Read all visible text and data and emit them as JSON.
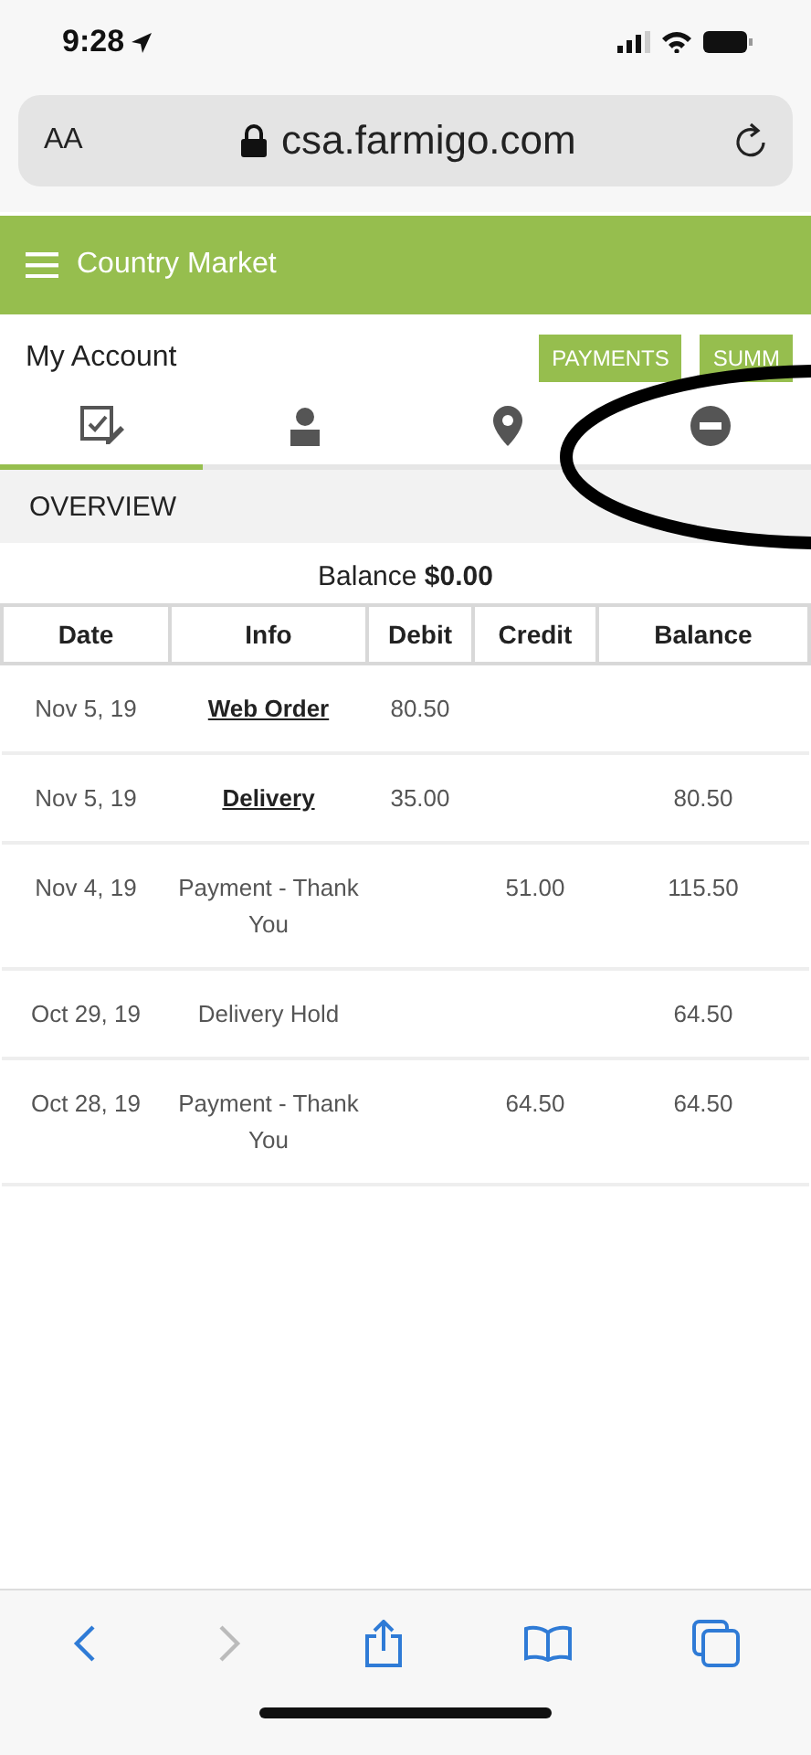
{
  "status_bar": {
    "time": "9:28"
  },
  "browser": {
    "text_size": "AA",
    "url": "csa.farmigo.com"
  },
  "header": {
    "title": "Country Market"
  },
  "account": {
    "title": "My Account",
    "buttons": [
      "PAYMENTS",
      "SUMM"
    ]
  },
  "tabs": [
    {
      "kind": "orders",
      "selected": true
    },
    {
      "kind": "profile",
      "selected": false
    },
    {
      "kind": "location",
      "selected": false
    },
    {
      "kind": "hold",
      "selected": false
    }
  ],
  "section": {
    "title": "OVERVIEW"
  },
  "balance": {
    "label": "Balance",
    "amount": "$0.00"
  },
  "table": {
    "columns": [
      "Date",
      "Info",
      "Debit",
      "Credit",
      "Balance"
    ],
    "rows": [
      {
        "date": "Nov 5, 19",
        "info": "Web Order",
        "link": true,
        "debit": "80.50",
        "credit": "",
        "balance": ""
      },
      {
        "date": "Nov 5, 19",
        "info": "Delivery",
        "link": true,
        "debit": "35.00",
        "credit": "",
        "balance": "80.50"
      },
      {
        "date": "Nov 4, 19",
        "info": "Payment - Thank You",
        "link": false,
        "debit": "",
        "credit": "51.00",
        "balance": "115.50"
      },
      {
        "date": "Oct 29, 19",
        "info": "Delivery Hold",
        "link": false,
        "debit": "",
        "credit": "",
        "balance": "64.50"
      },
      {
        "date": "Oct 28, 19",
        "info": "Payment - Thank You",
        "link": false,
        "debit": "",
        "credit": "64.50",
        "balance": "64.50"
      }
    ]
  },
  "annotation": {
    "kind": "ellipse"
  }
}
